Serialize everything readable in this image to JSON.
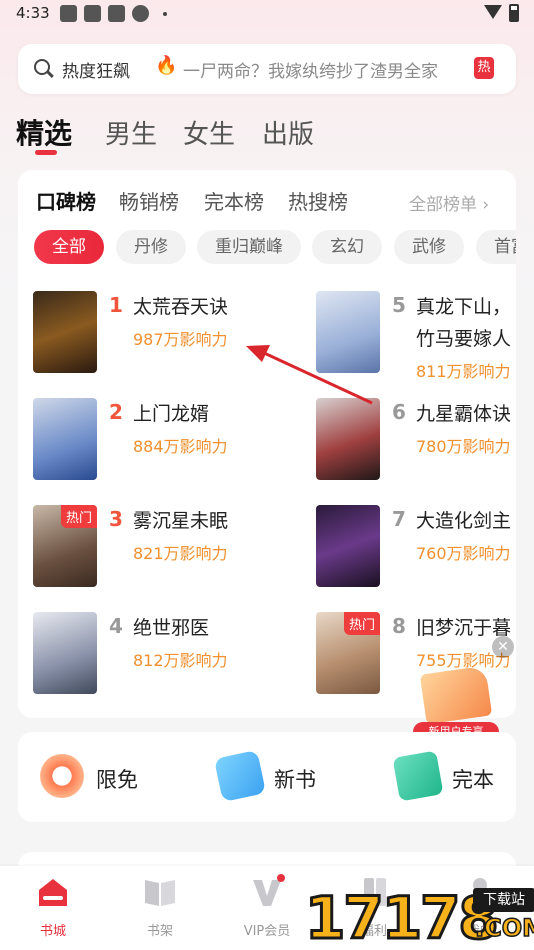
{
  "status_bar": {
    "time": "4:33"
  },
  "search": {
    "hot_label": "热度狂飙",
    "fire_icon": "🔥",
    "query": "一尸两命？我嫁纨绔抄了渣男全家",
    "hot_badge": "热"
  },
  "top_tabs": [
    "精选",
    "男生",
    "女生",
    "出版"
  ],
  "rank_tabs": [
    "口碑榜",
    "畅销榜",
    "完本榜",
    "热搜榜"
  ],
  "all_ranks": "全部榜单 ›",
  "chips": [
    "全部",
    "丹修",
    "重归巅峰",
    "玄幻",
    "武修",
    "首富"
  ],
  "books": [
    {
      "rank": "1",
      "title": "太荒吞天诀",
      "influence": "987万影响力",
      "tag": ""
    },
    {
      "rank": "2",
      "title": "上门龙婿",
      "influence": "884万影响力",
      "tag": ""
    },
    {
      "rank": "3",
      "title": "雾沉星未眠",
      "influence": "821万影响力",
      "tag": "热门"
    },
    {
      "rank": "4",
      "title": "绝世邪医",
      "influence": "812万影响力",
      "tag": ""
    },
    {
      "rank": "5",
      "title": "真龙下山，",
      "title_line2": "竹马要嫁人",
      "influence": "811万影响力",
      "tag": ""
    },
    {
      "rank": "6",
      "title": "九星霸体诀",
      "influence": "780万影响力",
      "tag": ""
    },
    {
      "rank": "7",
      "title": "大造化剑主",
      "influence": "760万影响力",
      "tag": ""
    },
    {
      "rank": "8",
      "title": "旧梦沉于暮",
      "influence": "755万影响力",
      "tag": "热门"
    }
  ],
  "new_user_badge": "新用户专享",
  "quick_entries": [
    "限免",
    "新书",
    "完本"
  ],
  "bottom_nav": [
    "书城",
    "书架",
    "VIP会员",
    "福利",
    "我的"
  ],
  "watermark": {
    "number": "17178",
    "site": "下载站",
    "domain": ".COM"
  },
  "colors": {
    "accent": "#e8323e",
    "influence": "#f0902e"
  }
}
